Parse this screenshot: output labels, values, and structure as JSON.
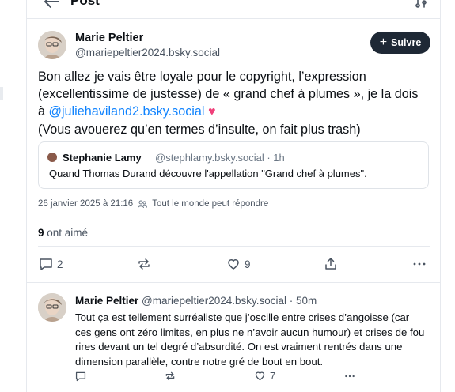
{
  "header": {
    "title": "Post"
  },
  "post": {
    "author_name": "Marie Peltier",
    "author_handle": "@mariepeltier2024.bsky.social",
    "follow_label": "Suivre",
    "text_part1": "Bon allez je vais être loyale pour le copyright, l’expression (excellentissime de justesse) de « grand chef à plumes », je la dois à ",
    "mention": "@juliehaviland2.bsky.social",
    "emoji": "♥",
    "text_part2": "(Vous avouerez qu’en termes d’insulte, on fait plus trash)",
    "quote": {
      "name": "Stephanie Lamy",
      "handle": "@stephlamy.bsky.social · 1h",
      "text": "Quand Thomas Durand découvre l'appellation \"Grand chef à plumes\"."
    },
    "timestamp": "26 janvier 2025 à 21:16",
    "reply_permission": "Tout le monde peut répondre",
    "likes_count": "9",
    "likes_label": "ont aimé",
    "actions": {
      "replies": "2",
      "likes": "9"
    }
  },
  "reply": {
    "author_name": "Marie Peltier",
    "author_handle": "@mariepeltier2024.bsky.social · 50m",
    "text": "Tout ça est tellement surréaliste que j’oscille entre crises d’angoisse (car ces gens ont zéro limites, en plus ne n’avoir aucun humour) et crises de fou rires devant un tel degré d’absurdité. On est vraiment rentrés dans une dimension parallèle, contre notre gré de bout en bout.",
    "actions": {
      "likes": "7"
    }
  },
  "colors": {
    "accent": "#1083fe",
    "button_bg": "#1e2835",
    "heart": "#f0407a"
  }
}
